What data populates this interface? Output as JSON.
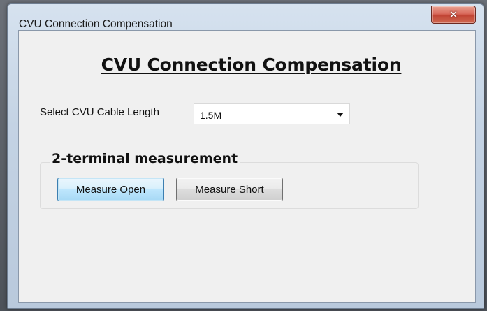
{
  "window": {
    "title": "CVU Connection Compensation",
    "close_symbol": "✕"
  },
  "dialog": {
    "heading": "CVU Connection Compensation",
    "cable_length": {
      "label": "Select CVU Cable Length",
      "selected": "1.5M"
    },
    "group": {
      "title": "2-terminal measurement",
      "buttons": {
        "open": "Measure Open",
        "short": "Measure Short"
      }
    }
  },
  "colors": {
    "close_button": "#c14434",
    "focused_button_border": "#3c7fb1",
    "client_background": "#f0f0f0"
  },
  "icons": {
    "close": "close-icon",
    "dropdown": "chevron-down-icon"
  }
}
